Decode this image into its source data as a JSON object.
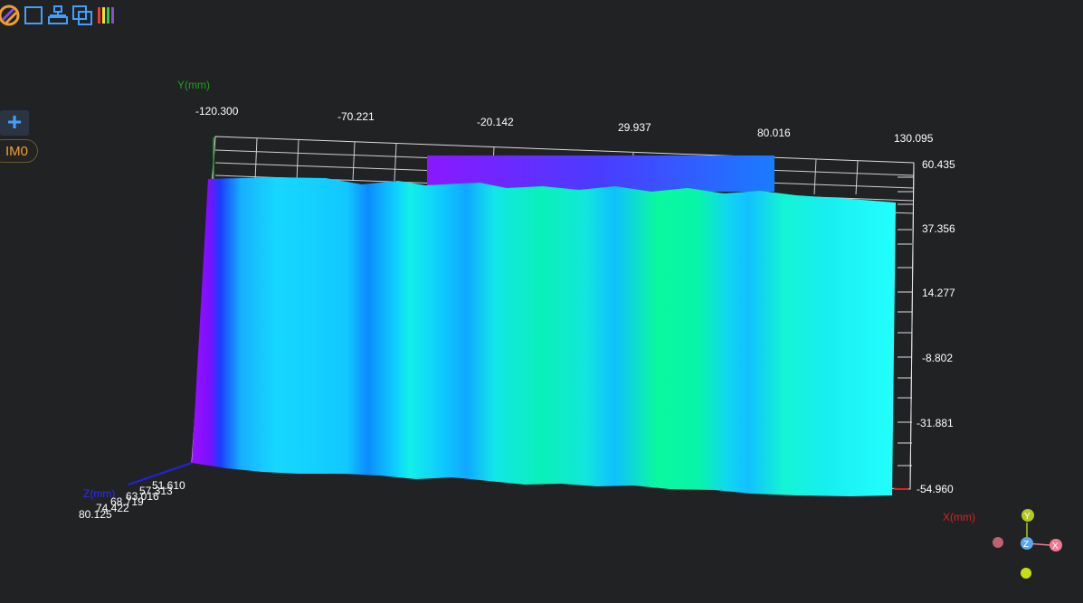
{
  "toolbar": {
    "buttons": [
      {
        "name": "view-mode-icon",
        "color": "#f0a030"
      },
      {
        "name": "frame-icon",
        "color": "#3fa0ff"
      },
      {
        "name": "layout-icon",
        "color": "#3fa0ff"
      },
      {
        "name": "copy-icon",
        "color": "#3fa0ff"
      },
      {
        "name": "color-bar-icon",
        "color": "#ff3030"
      }
    ]
  },
  "sidebar": {
    "add_label": "+",
    "layer_label": "IM0"
  },
  "axes": {
    "y_title": "Y(mm)",
    "x_title": "X(mm)",
    "z_title": "Z(mm)",
    "x_ticks": [
      "-120.300",
      "-70.221",
      "-20.142",
      "29.937",
      "80.016",
      "130.095"
    ],
    "y_ticks": [
      "60.435",
      "37.356",
      "14.277",
      "-8.802",
      "-31.881",
      "-54.960"
    ],
    "z_ticks": [
      "51.610",
      "57.313",
      "63.016",
      "68.719",
      "74.422",
      "80.125"
    ]
  },
  "gizmo": {
    "y": "Y",
    "z": "Z",
    "x": "X",
    "y_color": "#b6c820",
    "z_color": "#5aa8e8",
    "x_color": "#f07a94"
  }
}
